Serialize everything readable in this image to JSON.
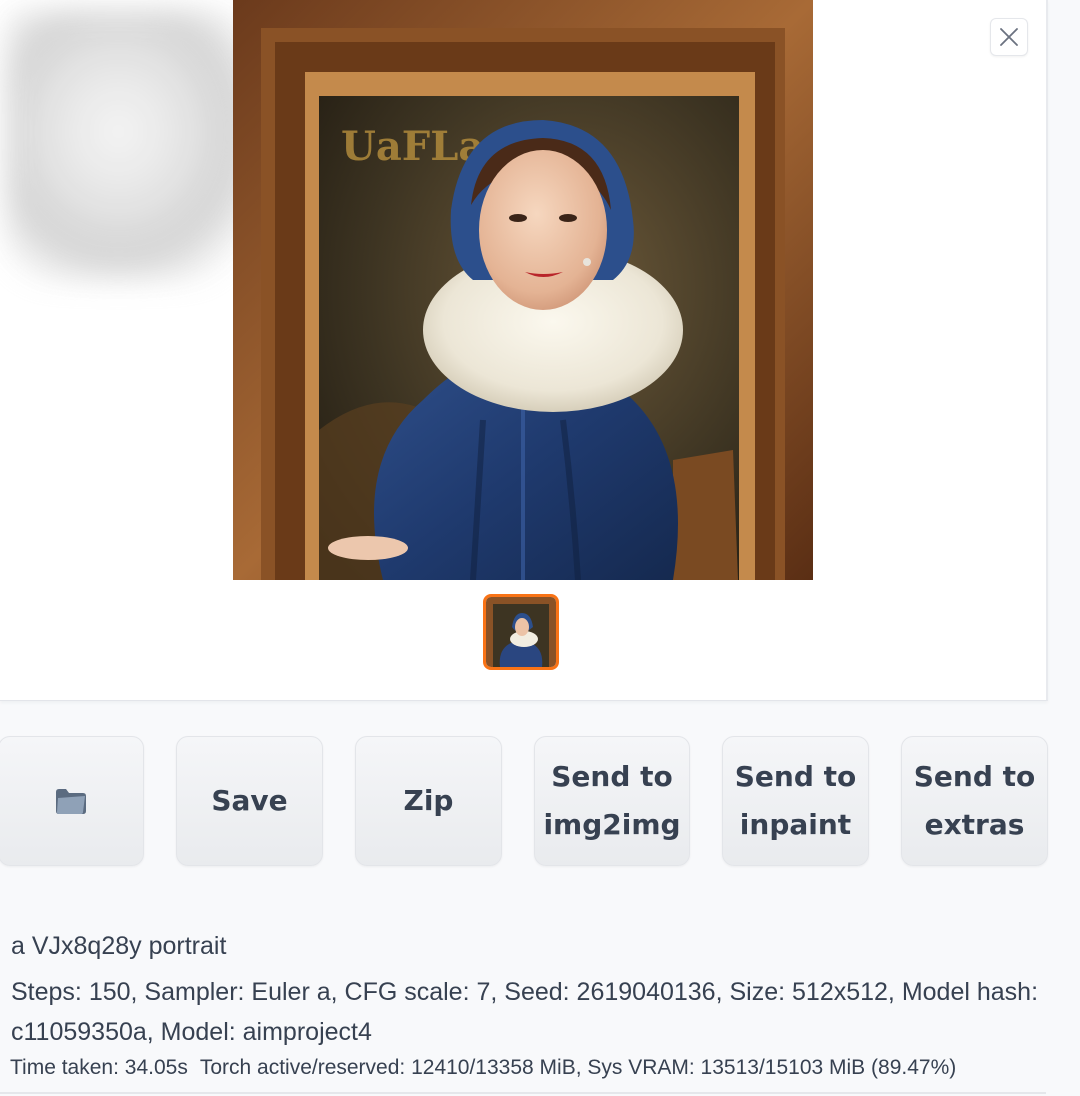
{
  "gallery": {
    "main_image_name": "portrait-painting",
    "thumbnail_count": 1,
    "selected_thumbnail": 1,
    "accent_color": "#f97316"
  },
  "buttons": {
    "open_folder_icon": "folder-icon",
    "save_label": "Save",
    "zip_label": "Zip",
    "send_img2img_line1": "Send to",
    "send_img2img_line2": "img2img",
    "send_inpaint_line1": "Send to",
    "send_inpaint_line2": "inpaint",
    "send_extras_line1": "Send to",
    "send_extras_line2": "extras"
  },
  "generation_info": {
    "prompt": "a VJx8q28y portrait",
    "params": "Steps: 150, Sampler: Euler a, CFG scale: 7, Seed: 2619040136, Size: 512x512, Model hash: c11059350a, Model: aimproject4",
    "time_taken": "Time taken: 34.05s",
    "memory": "Torch active/reserved: 12410/13358 MiB, Sys VRAM: 13513/15103 MiB (89.47%)"
  }
}
